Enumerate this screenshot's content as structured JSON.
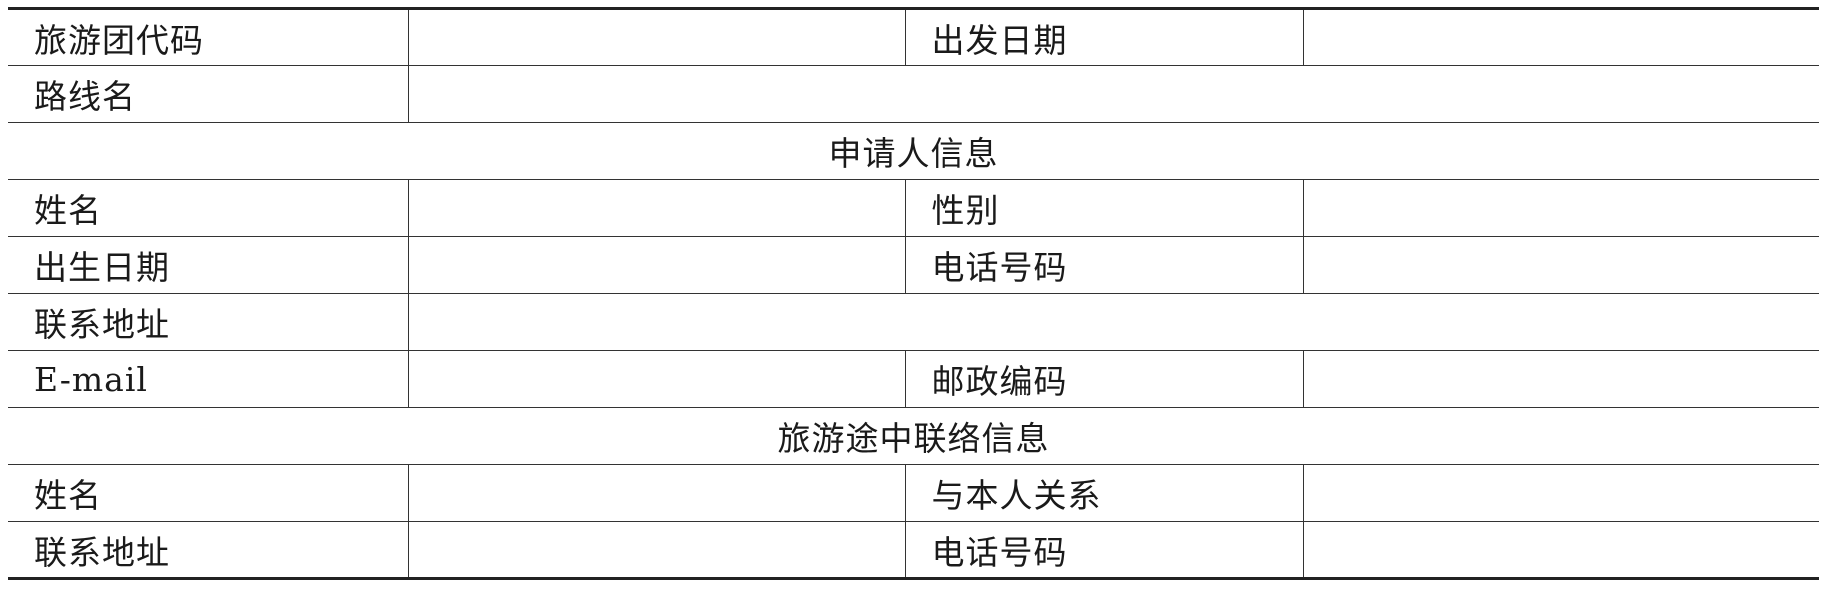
{
  "form": {
    "row1": {
      "label_a": "旅游团代码",
      "label_b": "出发日期"
    },
    "row2": {
      "label_a": "路线名"
    },
    "section_applicant": "申请人信息",
    "row3": {
      "label_a": "姓名",
      "label_b": "性别"
    },
    "row4": {
      "label_a": "出生日期",
      "label_b": "电话号码"
    },
    "row5": {
      "label_a": "联系地址"
    },
    "row6": {
      "label_a": "E-mail",
      "label_b": "邮政编码"
    },
    "section_contact": "旅游途中联络信息",
    "row7": {
      "label_a": "姓名",
      "label_b": "与本人关系"
    },
    "row8": {
      "label_a": "联系地址",
      "label_b": "电话号码"
    }
  }
}
